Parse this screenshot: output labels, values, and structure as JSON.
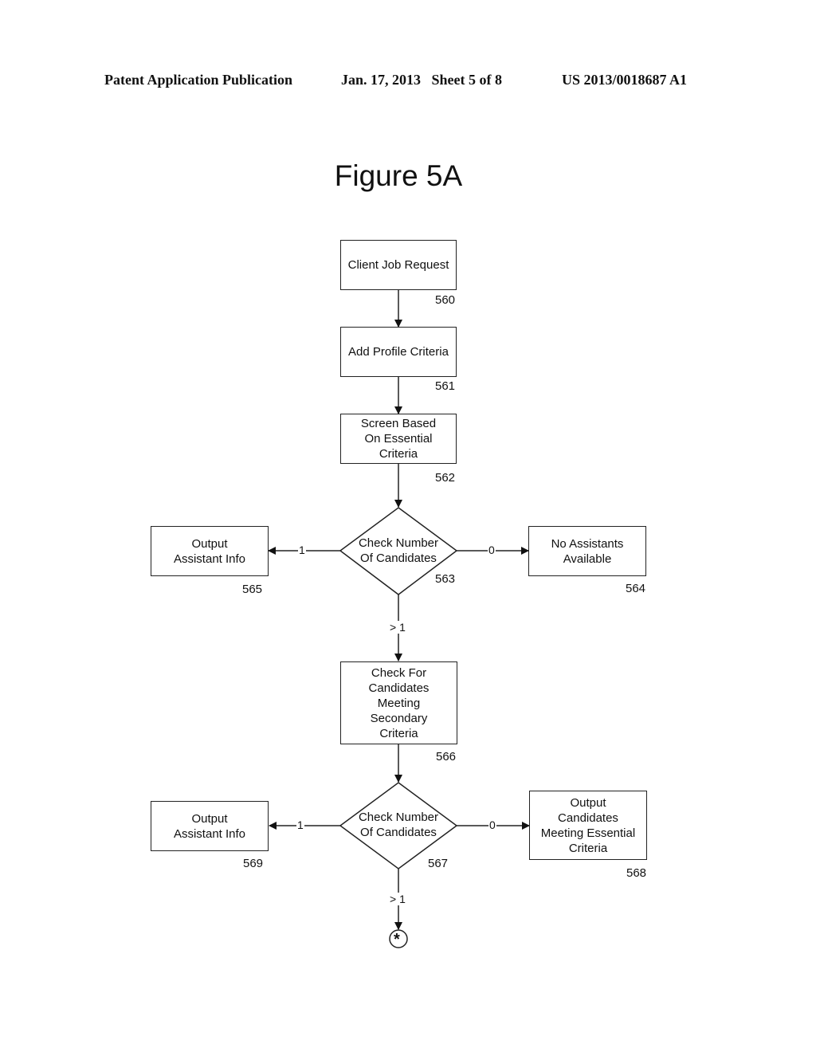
{
  "header": {
    "publication": "Patent Application Publication",
    "date_sheet": "Jan. 17, 2013   Sheet 5 of 8",
    "patent_number": "US 2013/0018687 A1"
  },
  "figure_title": "Figure 5A",
  "nodes": {
    "n560": {
      "label": "Client Job Request",
      "ref": "560"
    },
    "n561": {
      "label": "Add Profile Criteria",
      "ref": "561"
    },
    "n562": {
      "label": "Screen Based\nOn Essential\nCriteria",
      "ref": "562"
    },
    "n563": {
      "label": "Check Number\nOf Candidates",
      "ref": "563"
    },
    "n564": {
      "label": "No Assistants\nAvailable",
      "ref": "564"
    },
    "n565": {
      "label": "Output\nAssistant Info",
      "ref": "565"
    },
    "n566": {
      "label": "Check For\nCandidates\nMeeting\nSecondary\nCriteria",
      "ref": "566"
    },
    "n567": {
      "label": "Check Number\nOf Candidates",
      "ref": "567"
    },
    "n568": {
      "label": "Output\nCandidates\nMeeting Essential\nCriteria",
      "ref": "568"
    },
    "n569": {
      "label": "Output\nAssistant Info",
      "ref": "569"
    }
  },
  "edges": {
    "e563_565": "1",
    "e563_564": "0",
    "e563_566": "> 1",
    "e567_569": "1",
    "e567_568": "0",
    "e567_cont": "> 1"
  },
  "connector": {
    "symbol": "*"
  }
}
